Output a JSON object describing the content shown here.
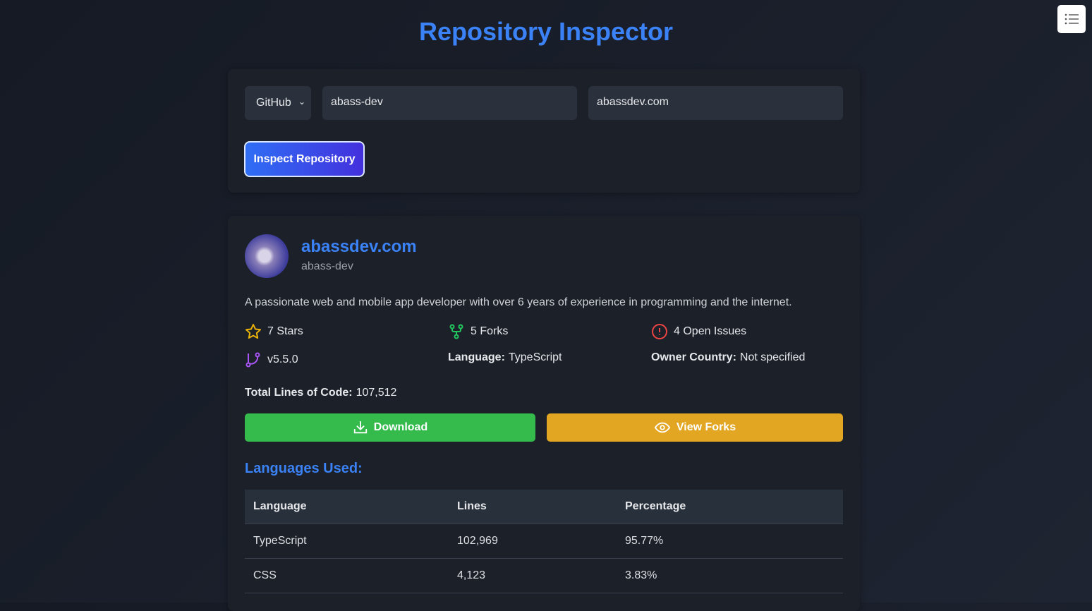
{
  "title": "Repository Inspector",
  "form": {
    "platform": "GitHub",
    "owner_value": "abass-dev",
    "repo_value": "abassdev.com",
    "inspect_label": "Inspect Repository"
  },
  "repo": {
    "name": "abassdev.com",
    "owner": "abass-dev",
    "description": "A passionate web and mobile app developer with over 6 years of experience in programming and the internet.",
    "stars": "7 Stars",
    "forks": "5 Forks",
    "issues": "4 Open Issues",
    "version": "v5.5.0",
    "language_label": "Language:",
    "language": "TypeScript",
    "country_label": "Owner Country:",
    "country": "Not specified",
    "loc_label": "Total Lines of Code:",
    "loc": "107,512",
    "download_label": "Download",
    "view_forks_label": "View Forks"
  },
  "languages": {
    "title": "Languages Used:",
    "headers": [
      "Language",
      "Lines",
      "Percentage"
    ],
    "rows": [
      [
        "TypeScript",
        "102,969",
        "95.77%"
      ],
      [
        "CSS",
        "4,123",
        "3.83%"
      ]
    ]
  },
  "colors": {
    "accent": "#3b82f6",
    "download": "#34bb4c",
    "view_forks": "#e2a622",
    "star": "#eab308",
    "fork": "#22c55e",
    "issue": "#ef4444",
    "version": "#a855f7"
  }
}
